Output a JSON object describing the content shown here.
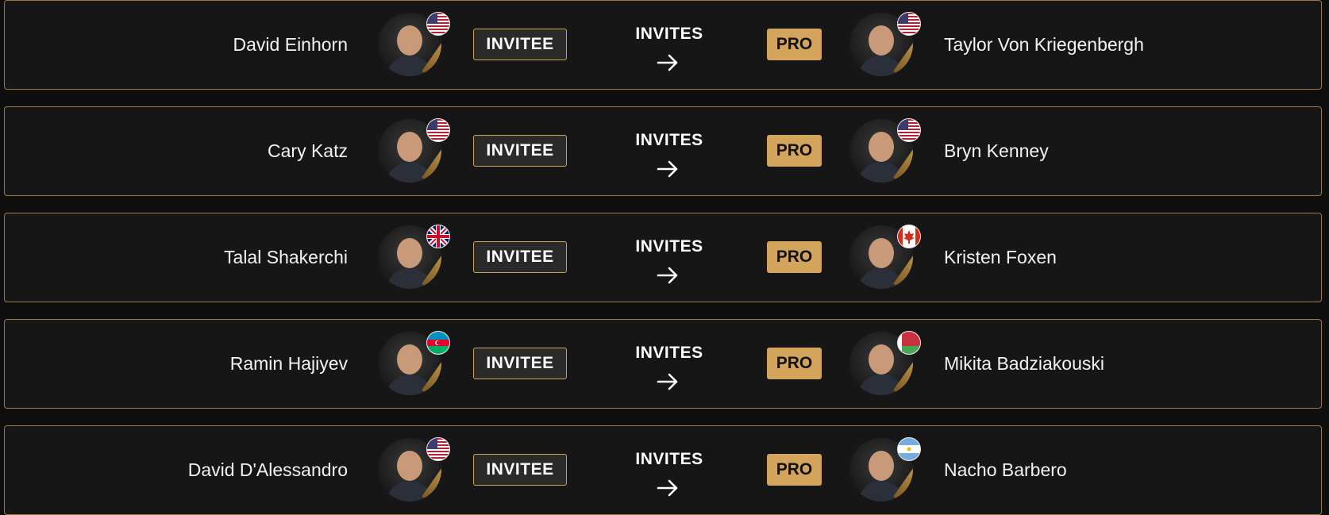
{
  "pairs": [
    {
      "invitee": "David Einhorn",
      "invitee_flag": "us",
      "pro": "Taylor Von Kriegenbergh",
      "pro_flag": "us"
    },
    {
      "invitee": "Cary Katz",
      "invitee_flag": "us",
      "pro": "Bryn Kenney",
      "pro_flag": "us"
    },
    {
      "invitee": "Talal Shakerchi",
      "invitee_flag": "uk",
      "pro": "Kristen Foxen",
      "pro_flag": "ca"
    },
    {
      "invitee": "Ramin Hajiyev",
      "invitee_flag": "az",
      "pro": "Mikita Badziakouski",
      "pro_flag": "by"
    },
    {
      "invitee": "David D'Alessandro",
      "invitee_flag": "us",
      "pro": "Nacho Barbero",
      "pro_flag": "ar"
    }
  ],
  "labels": {
    "invitee_badge": "INVITEE",
    "invites": "INVITES",
    "pro_badge": "PRO"
  },
  "icons": {
    "arrow": "arrow-right-icon",
    "avatar": "player-avatar",
    "flag": "country-flag-icon"
  },
  "colors": {
    "accent_gold": "#d3a45c",
    "border_gold": "#9a7a42",
    "row_bg": "#161616",
    "page_bg": "#0e0e0e"
  }
}
